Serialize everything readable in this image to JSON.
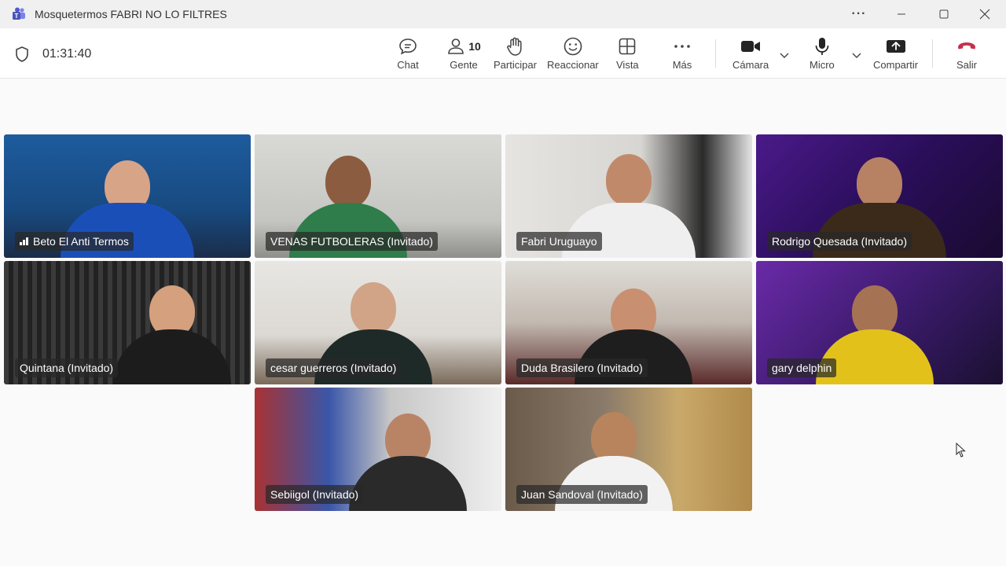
{
  "window": {
    "title": "Mosquetermos FABRI NO LO FILTRES",
    "controls": [
      "more-options-icon",
      "minimize-icon",
      "maximize-icon",
      "close-icon"
    ]
  },
  "meeting": {
    "elapsed": "01:31:40"
  },
  "toolbar": {
    "chat_label": "Chat",
    "people_label": "Gente",
    "people_count": "10",
    "raise_label": "Participar",
    "react_label": "Reaccionar",
    "view_label": "Vista",
    "more_label": "Más",
    "camera_label": "Cámara",
    "mic_label": "Micro",
    "share_label": "Compartir",
    "leave_label": "Salir"
  },
  "colors": {
    "accent": "#6264a7",
    "leave": "#c4314b",
    "toolbar_bg": "#ffffff",
    "page_bg": "#fafafa"
  },
  "participants": [
    {
      "name": "Beto El Anti Termos",
      "speaking": false,
      "signal": true
    },
    {
      "name": "VENAS FUTBOLERAS (Invitado)",
      "speaking": true,
      "signal": false
    },
    {
      "name": "Fabri Uruguayo",
      "speaking": false,
      "signal": false
    },
    {
      "name": "Rodrigo Quesada (Invitado)",
      "speaking": true,
      "signal": false
    },
    {
      "name": "Quintana (Invitado)",
      "speaking": false,
      "signal": false
    },
    {
      "name": "cesar guerreros (Invitado)",
      "speaking": false,
      "signal": false
    },
    {
      "name": "Duda Brasilero (Invitado)",
      "speaking": false,
      "signal": false
    },
    {
      "name": "gary delphin",
      "speaking": true,
      "signal": false
    },
    {
      "name": "Sebiigol (Invitado)",
      "speaking": false,
      "signal": false
    },
    {
      "name": "Juan Sandoval (Invitado)",
      "speaking": true,
      "signal": false
    }
  ]
}
